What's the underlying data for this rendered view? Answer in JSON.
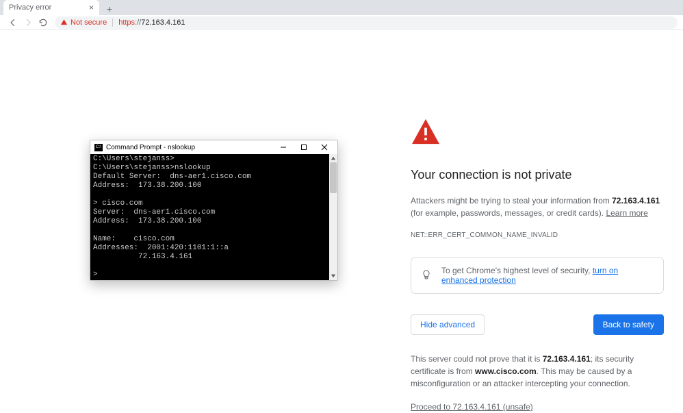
{
  "tab": {
    "title": "Privacy error"
  },
  "addr": {
    "not_secure_label": "Not secure",
    "scheme": "https",
    "sep": "://",
    "host": "72.163.4.161"
  },
  "warn": {
    "title": "Your connection is not private",
    "body_prefix": "Attackers might be trying to steal your information from ",
    "body_ip": "72.163.4.161",
    "body_suffix": " (for example, passwords, messages, or credit cards). ",
    "learn_more": "Learn more",
    "err_code": "NET::ERR_CERT_COMMON_NAME_INVALID",
    "enhanced_prefix": "To get Chrome's highest level of security, ",
    "enhanced_link": "turn on enhanced protection",
    "hide_advanced": "Hide advanced",
    "back_to_safety": "Back to safety",
    "adv1_a": "This server could not prove that it is ",
    "adv1_b": "72.163.4.161",
    "adv1_c": "; its security certificate is from ",
    "adv1_d": "www.cisco.com",
    "adv1_e": ". This may be caused by a misconfiguration or an attacker intercepting your connection.",
    "proceed": "Proceed to 72.163.4.161 (unsafe)"
  },
  "cmd": {
    "title": "Command Prompt - nslookup",
    "icon_text": "C:\\",
    "lines": "C:\\Users\\stejanss>\nC:\\Users\\stejanss>nslookup\nDefault Server:  dns-aer1.cisco.com\nAddress:  173.38.200.100\n\n> cisco.com\nServer:  dns-aer1.cisco.com\nAddress:  173.38.200.100\n\nName:    cisco.com\nAddresses:  2001:420:1101:1::a\n          72.163.4.161\n\n>"
  }
}
